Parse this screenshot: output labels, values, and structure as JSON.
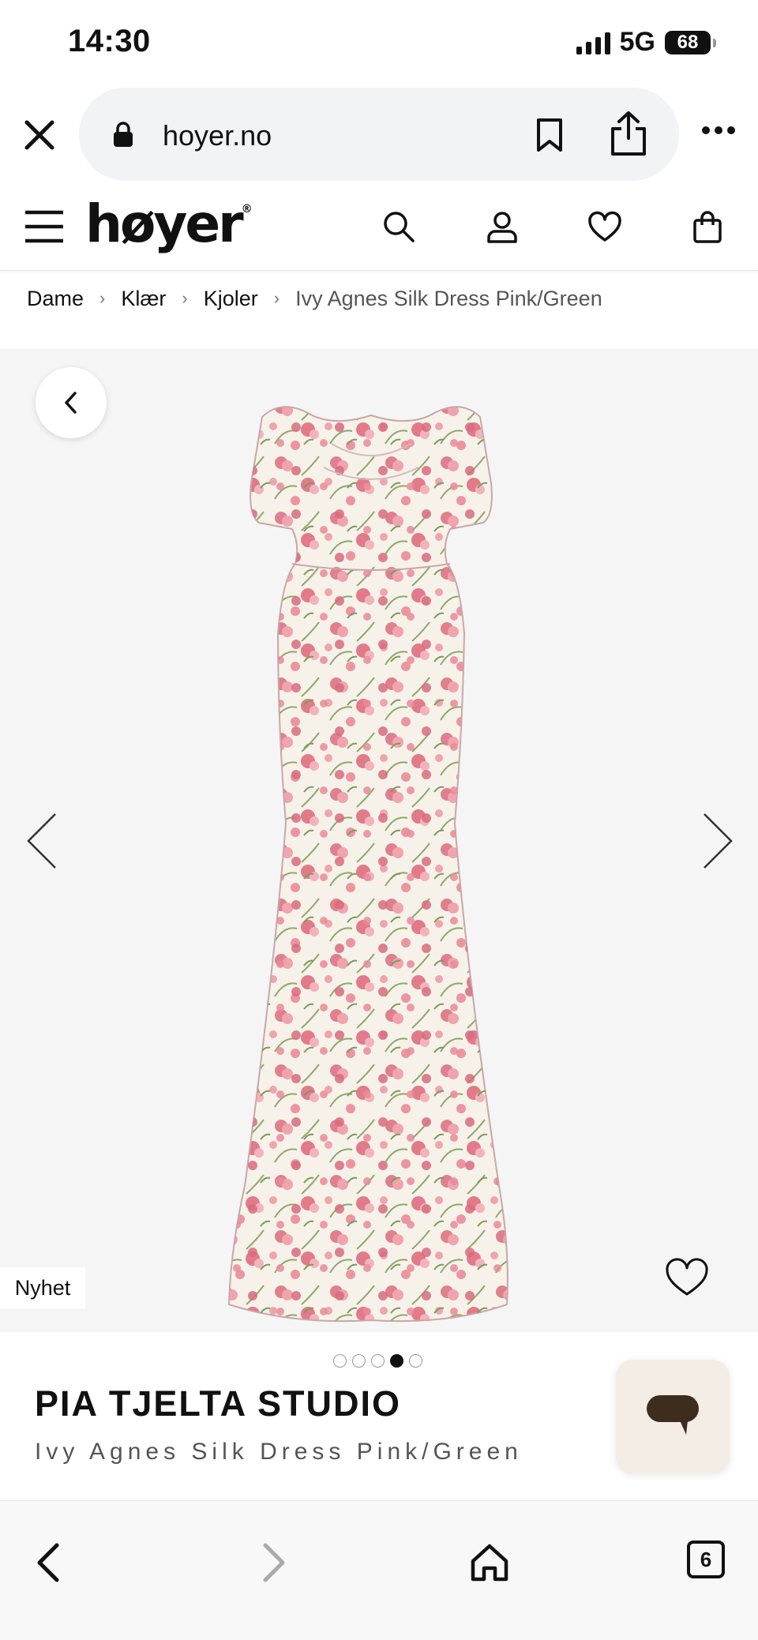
{
  "status_bar": {
    "time": "14:30",
    "network": "5G",
    "battery": "68"
  },
  "browser": {
    "url": "hoyer.no",
    "tab_count": "6"
  },
  "site": {
    "logo": "høyer",
    "logo_mark": "®"
  },
  "breadcrumb": [
    {
      "label": "Dame"
    },
    {
      "label": "Klær"
    },
    {
      "label": "Kjoler"
    },
    {
      "label": "Ivy Agnes Silk Dress Pink/Green"
    }
  ],
  "breadcrumb_separator": "›",
  "product": {
    "badge": "Nyhet",
    "brand": "PIA TJELTA STUDIO",
    "name": "Ivy Agnes Silk Dress Pink/Green",
    "image_count": 5,
    "active_image": 4
  },
  "icons": {
    "close": "close-icon",
    "lock": "lock-icon",
    "bookmark": "bookmark-icon",
    "share": "share-icon",
    "more": "more-icon",
    "menu": "hamburger-icon",
    "search": "search-icon",
    "account": "user-icon",
    "wishlist": "heart-icon",
    "cart": "shopping-bag-icon",
    "chat": "chat-icon"
  },
  "colors": {
    "accent": "#111111",
    "gallery_bg": "#f5f5f5",
    "chat_bg": "#f3ede5",
    "chat_icon": "#3e2d1e",
    "print_pink": "#e07f8e",
    "print_green": "#8fa86a"
  }
}
